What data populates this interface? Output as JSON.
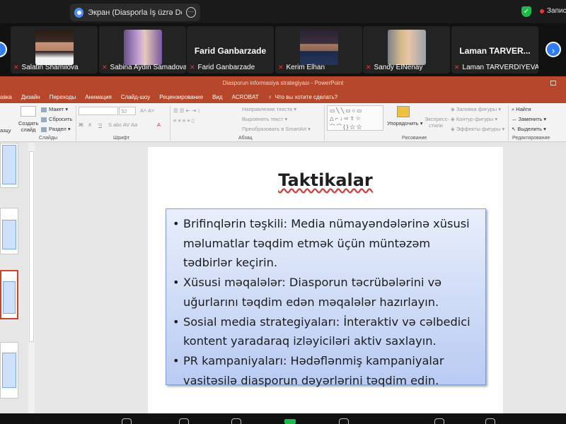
{
  "meeting": {
    "share_indicator": "Экран (Diasporla İş üzrə Dövlət",
    "recording_label": "Запис"
  },
  "participants": [
    {
      "name": "Salatin Shamilova",
      "has_video": true
    },
    {
      "name": "Sabina Aydin Samadova",
      "has_video": true
    },
    {
      "name": "Farid Ganbarzade",
      "has_video": false,
      "display": "Farid Ganbarzade"
    },
    {
      "name": "Kerim Elhan",
      "has_video": true
    },
    {
      "name": "Sandy ElNenay",
      "has_video": true
    },
    {
      "name": "Laman TARVERDIYEVA",
      "has_video": false,
      "display": "Laman TARVER..."
    }
  ],
  "ppt": {
    "window_title": "Diasporun informasiya strategiyası - PowerPoint",
    "tabs": [
      "авка",
      "Дизайн",
      "Переходы",
      "Анимация",
      "Слайд-шоу",
      "Рецензирование",
      "Вид",
      "ACROBAT"
    ],
    "tell_me": "Что вы хотите сделать?",
    "ribbon": {
      "create_slide": "Создать слайд",
      "paste": "азцу",
      "layout": "Макет",
      "reset": "Сбросить",
      "section": "Раздел",
      "group_slides": "Слайды",
      "font_size": "32",
      "group_font": "Шрифт",
      "text_direction": "Направление текста",
      "align_text": "Выровнять текст",
      "convert_smartart": "Преобразовать в SmartArt",
      "group_paragraph": "Абзац",
      "arrange": "Упорядочить",
      "quick_styles": "Экспресс-стили",
      "shape_fill": "Заливка фигуры",
      "shape_outline": "Контур фигуры",
      "shape_effects": "Эффекты фигуры",
      "group_drawing": "Рисование",
      "find": "Найти",
      "replace": "Заменить",
      "select": "Выделить",
      "group_editing": "Редактирование"
    }
  },
  "slide": {
    "title": "Taktikalar",
    "bullets": [
      "Brifinqlərin təşkili: Media nümayəndələrinə xüsusi məlumatlar təqdim etmək üçün müntəzəm tədbirlər keçirin.",
      "Xüsusi məqalələr: Diasporun təcrübələrini və uğurlarını təqdim edən məqalələr hazırlayın.",
      "Sosial media strategiyaları: İnteraktiv və cəlbedici kontent yaradaraq izləyiciləri aktiv saxlayın.",
      "PR kampaniyaları: Hədəflənmiş kampaniyalar vasitəsilə diasporun dəyərlərini təqdim edin."
    ]
  },
  "colors": {
    "ppt_accent": "#b7472a",
    "zoom_blue": "#2f7cf6",
    "slide_box_top": "#e8eefb",
    "slide_box_bottom": "#b9cbf3"
  }
}
